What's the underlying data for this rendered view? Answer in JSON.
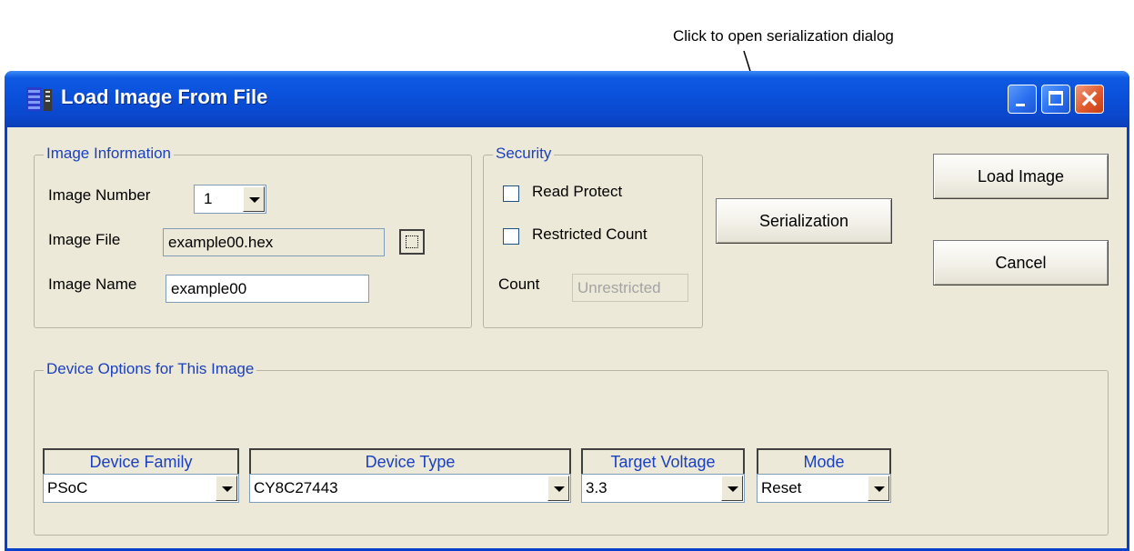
{
  "annotation": {
    "text": "Click to open serialization dialog"
  },
  "window": {
    "title": "Load Image From File",
    "colors": {
      "titlebar": "#0a50da",
      "body": "#ece9d8",
      "legend": "#1a3fbf"
    }
  },
  "image_info": {
    "legend": "Image Information",
    "number_label": "Image Number",
    "number_value": "1",
    "file_label": "Image File",
    "file_value": "example00.hex",
    "name_label": "Image Name",
    "name_value": "example00"
  },
  "security": {
    "legend": "Security",
    "read_protect": {
      "label": "Read Protect",
      "checked": false
    },
    "restricted_count": {
      "label": "Restricted Count",
      "checked": false
    },
    "count_label": "Count",
    "count_value": "Unrestricted"
  },
  "buttons": {
    "serialization": "Serialization",
    "load_image": "Load Image",
    "cancel": "Cancel"
  },
  "device_options": {
    "legend": "Device Options for This Image",
    "columns": [
      {
        "header": "Device Family",
        "value": "PSoC"
      },
      {
        "header": "Device Type",
        "value": "CY8C27443"
      },
      {
        "header": "Target Voltage",
        "value": "3.3"
      },
      {
        "header": "Mode",
        "value": "Reset"
      }
    ]
  }
}
